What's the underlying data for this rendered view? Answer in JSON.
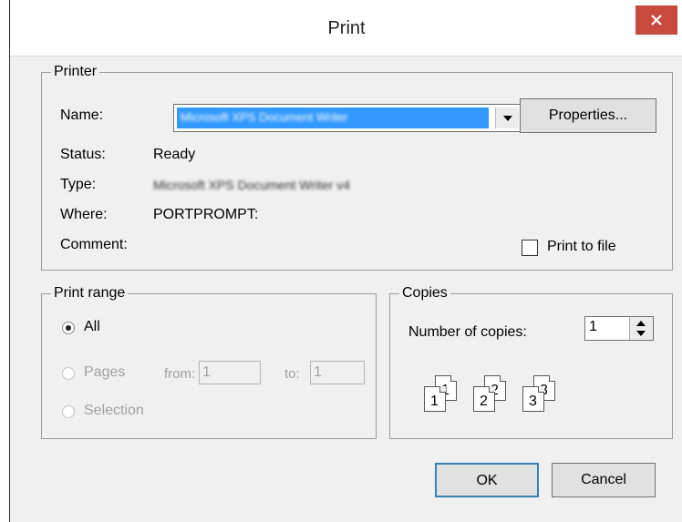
{
  "window": {
    "title": "Print"
  },
  "printer": {
    "group_label": "Printer",
    "name_label": "Name:",
    "name_value": "Microsoft XPS Document Writer",
    "properties_button": "Properties...",
    "status_label": "Status:",
    "status_value": "Ready",
    "type_label": "Type:",
    "type_value": "Microsoft XPS Document Writer v4",
    "where_label": "Where:",
    "where_value": "PORTPROMPT:",
    "comment_label": "Comment:",
    "print_to_file_label": "Print to file",
    "print_to_file_checked": false
  },
  "print_range": {
    "group_label": "Print range",
    "all_label": "All",
    "pages_label": "Pages",
    "from_label": "from:",
    "from_value": "1",
    "to_label": "to:",
    "to_value": "1",
    "selection_label": "Selection",
    "selected": "All"
  },
  "copies": {
    "group_label": "Copies",
    "number_label": "Number of copies:",
    "number_value": "1",
    "collate_pages": [
      "1",
      "1",
      "2",
      "2",
      "3",
      "3"
    ]
  },
  "buttons": {
    "ok": "OK",
    "cancel": "Cancel"
  },
  "icons": {
    "close": "close-icon",
    "dropdown": "chevron-down-icon"
  },
  "colors": {
    "selection": "#3399ff",
    "close_button": "#c74a3d",
    "dialog_bg": "#f0f0f0"
  }
}
